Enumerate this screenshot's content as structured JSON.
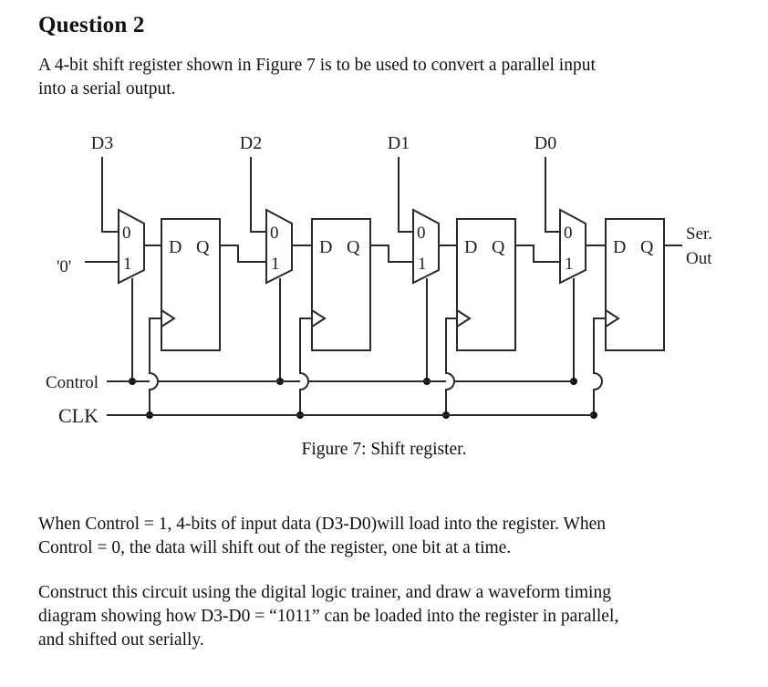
{
  "question": {
    "heading": "Question 2",
    "intro_lines": [
      "A 4-bit shift register shown in Figure 7 is to be used to convert a parallel input",
      "into a serial output."
    ]
  },
  "figure": {
    "caption": "Figure 7: Shift register.",
    "stages": [
      {
        "input_label": "D3",
        "mux_in0": "0",
        "mux_in1": "1",
        "ff_d": "D",
        "ff_q": "Q"
      },
      {
        "input_label": "D2",
        "mux_in0": "0",
        "mux_in1": "1",
        "ff_d": "D",
        "ff_q": "Q"
      },
      {
        "input_label": "D1",
        "mux_in0": "0",
        "mux_in1": "1",
        "ff_d": "D",
        "ff_q": "Q"
      },
      {
        "input_label": "D0",
        "mux_in0": "0",
        "mux_in1": "1",
        "ff_d": "D",
        "ff_q": "Q"
      }
    ],
    "serial_in_label": "'0'",
    "control_label": "Control",
    "clock_label": "CLK",
    "output_label_line1": "Ser.",
    "output_label_line2": "Out"
  },
  "description_lines": [
    "When Control = 1, 4-bits of input data (D3-D0)will load into the register. When",
    "Control = 0, the data will shift out of the register, one bit at a time."
  ],
  "task_lines": [
    "Construct this circuit using the digital logic trainer, and draw a waveform timing",
    "diagram showing how D3-D0 = “1011” can be loaded into the register in parallel,",
    "and shifted out serially."
  ]
}
